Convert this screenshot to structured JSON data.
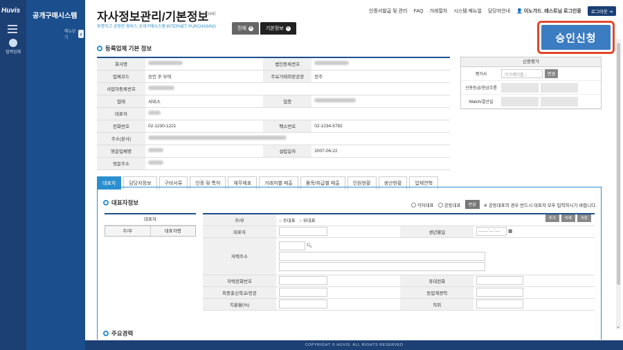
{
  "rail": {
    "logo": "Huvis",
    "nav_label": "협력업체"
  },
  "sidebar": {
    "brand": "공개구매시스템",
    "toggle_label": "메뉴닫기",
    "toggle_icon": "chevron-left-icon"
  },
  "header": {
    "title": "자사정보관리/기본정보",
    "home": "HOME",
    "subtitle": "투명하고 공정한 휴비스 공개구매시스템  INTERNET PURCHASING",
    "nav": [
      "인증서발급 및 관리",
      "FAQ",
      "거래절차",
      "시스템 매뉴얼",
      "담당자안내"
    ],
    "user": "이노가드_테스트님 로그인중",
    "logout": "로그아웃"
  },
  "page_tabs": [
    {
      "label": "전체"
    },
    {
      "label": "기본정보"
    }
  ],
  "approve_button": "승인신청",
  "company_section": {
    "title": "등록업체 기본 정보",
    "rows": [
      {
        "l1": "회사명",
        "v1": "",
        "l2": "법인등록번호",
        "v2": ""
      },
      {
        "l1": "업체코드",
        "v1": "승인 후 부여",
        "l2": "주요거래희망공장",
        "v2": "전주"
      },
      {
        "l1": "사업자등록번호",
        "v1": "",
        "l2": "",
        "v2": ""
      },
      {
        "l1": "업태",
        "v1": "서비스",
        "l2": "업종",
        "v2": ""
      },
      {
        "l1": "대표자",
        "v1": "",
        "l2": "",
        "v2": ""
      },
      {
        "l1": "전화번호",
        "v1": "02-1230-1221",
        "l2": "팩스번호",
        "v2": "02-1234-5782"
      },
      {
        "l1": "주소(본사)",
        "v1": "",
        "l2": "",
        "v2": ""
      },
      {
        "l1": "영문업체명",
        "v1": "",
        "l2": "설립일자",
        "v2": "2007-06-22"
      },
      {
        "l1": "영문주소",
        "v1": "",
        "l2": "",
        "v2": ""
      }
    ]
  },
  "credit": {
    "title": "신용평가",
    "agency_label": "평가사",
    "agency_value": "이크레더블",
    "change_btn": "변경",
    "grade_label": "신용등급/현금흐름",
    "watch_label": "Watch/결산일"
  },
  "bottom_tabs": [
    {
      "label": "대표자"
    },
    {
      "label": "담당자정보"
    },
    {
      "label": "구비서류"
    },
    {
      "label": "인증 및 특허"
    },
    {
      "label": "재무제표"
    },
    {
      "label": "거래처별 매출"
    },
    {
      "label": "품목/취급별 매출"
    },
    {
      "label": "인원현황"
    },
    {
      "label": "생산현황"
    },
    {
      "label": "업체연혁"
    }
  ],
  "rep_section": {
    "title": "대표자정보",
    "opt1": "각자대표",
    "opt2": "공동대표",
    "change_btn": "변경",
    "note": "※ 공동대표의 경우 반드시 대표자 모두 입력하시기 바랍니다.",
    "list_head": "대표자",
    "list_col1": "주/부",
    "list_col2": "대표자명",
    "btn_add": "추가",
    "btn_del": "삭제",
    "btn_save": "저장",
    "main_label": "주/부",
    "main_opt1": "주대표",
    "main_opt2": "부대표",
    "name_label": "대표자",
    "birth_label": "생년월일",
    "birth_placeholder": "____-__-__",
    "addr_label": "자택주소",
    "home_tel_label": "자택전화번호",
    "mobile_label": "휴대전화",
    "school_label": "최종출신학교/전공",
    "career_label": "동업계경력",
    "share_label": "지분율(%)",
    "position_label": "직위"
  },
  "next_section": "주요경력",
  "footer": "COPYRIGHT © HUVIS. ALL RIGHTS RESERVED"
}
